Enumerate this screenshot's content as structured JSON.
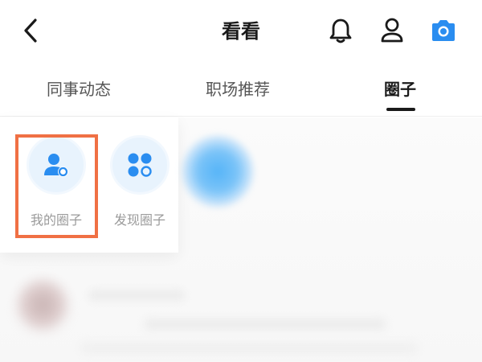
{
  "header": {
    "title": "看看",
    "icons": [
      "back-arrow-icon",
      "bell-icon",
      "user-icon",
      "camera-icon"
    ]
  },
  "tabs": [
    {
      "label": "同事动态",
      "active": false
    },
    {
      "label": "职场推荐",
      "active": false
    },
    {
      "label": "圈子",
      "active": true
    }
  ],
  "circles": {
    "entries": [
      {
        "label": "我的圈子",
        "icon": "my-circle-user-icon"
      },
      {
        "label": "发现圈子",
        "icon": "discover-circle-grid-icon"
      }
    ]
  },
  "colors": {
    "accent": "#2a8df0",
    "highlight": "#f07044",
    "title_text": "#1a1a1a",
    "muted_text": "#9a9a9a"
  }
}
